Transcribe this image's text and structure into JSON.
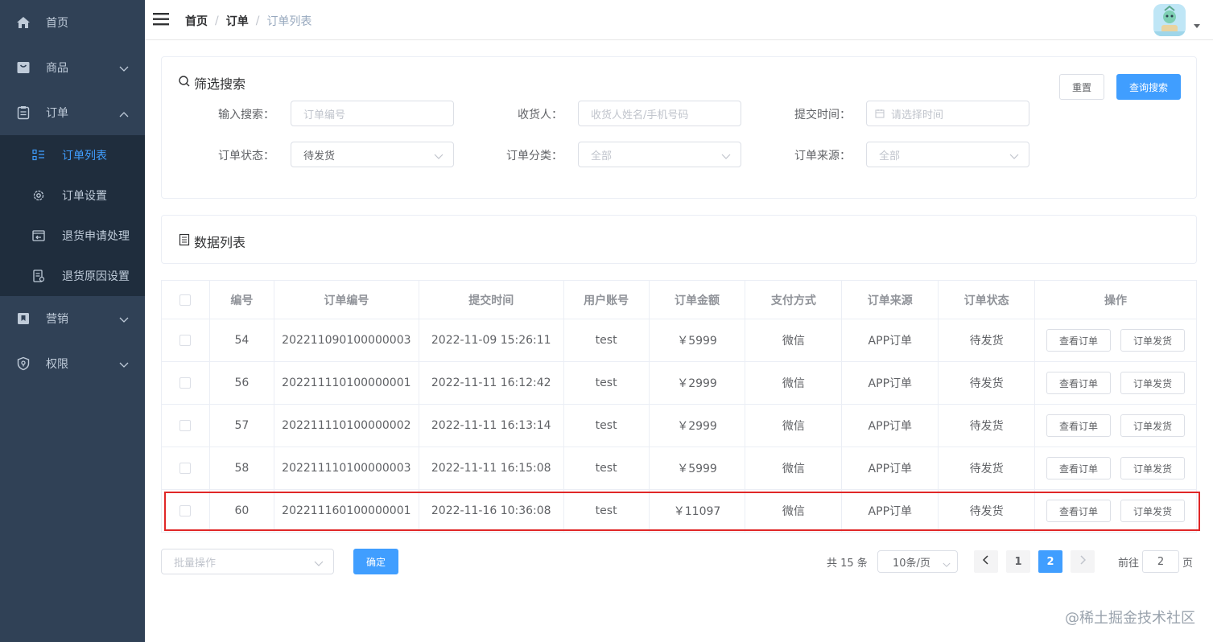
{
  "sidebar": {
    "items": [
      {
        "label": "首页",
        "icon": "home-icon"
      },
      {
        "label": "商品",
        "icon": "shopping-bag-icon"
      },
      {
        "label": "订单",
        "icon": "clipboard-icon"
      },
      {
        "label": "营销",
        "icon": "bookmark-icon"
      },
      {
        "label": "权限",
        "icon": "shield-icon"
      }
    ],
    "order_submenu": [
      {
        "label": "订单列表",
        "icon": "list-icon",
        "active": true
      },
      {
        "label": "订单设置",
        "icon": "gear-icon"
      },
      {
        "label": "退货申请处理",
        "icon": "return-icon"
      },
      {
        "label": "退货原因设置",
        "icon": "document-icon"
      }
    ]
  },
  "breadcrumb": [
    "首页",
    "订单",
    "订单列表"
  ],
  "breadcrumb_separator": "/",
  "filter": {
    "title": "筛选搜索",
    "reset_label": "重置",
    "search_label": "查询搜索",
    "fields": {
      "keyword": {
        "label": "输入搜索：",
        "placeholder": "订单编号"
      },
      "receiver": {
        "label": "收货人：",
        "placeholder": "收货人姓名/手机号码"
      },
      "submit_time": {
        "label": "提交时间：",
        "placeholder": "请选择时间"
      },
      "order_status": {
        "label": "订单状态：",
        "value": "待发货"
      },
      "order_category": {
        "label": "订单分类：",
        "placeholder": "全部"
      },
      "order_source": {
        "label": "订单来源：",
        "placeholder": "全部"
      }
    }
  },
  "data_list": {
    "title": "数据列表"
  },
  "table": {
    "columns": [
      "编号",
      "订单编号",
      "提交时间",
      "用户账号",
      "订单金额",
      "支付方式",
      "订单来源",
      "订单状态",
      "操作"
    ],
    "rows": [
      {
        "id": "54",
        "order_no": "202211090100000003",
        "time": "2022-11-09 15:26:11",
        "user": "test",
        "amount": "￥5999",
        "pay": "微信",
        "source": "APP订单",
        "status": "待发货"
      },
      {
        "id": "56",
        "order_no": "202211110100000001",
        "time": "2022-11-11 16:12:42",
        "user": "test",
        "amount": "￥2999",
        "pay": "微信",
        "source": "APP订单",
        "status": "待发货"
      },
      {
        "id": "57",
        "order_no": "202211110100000002",
        "time": "2022-11-11 16:13:14",
        "user": "test",
        "amount": "￥2999",
        "pay": "微信",
        "source": "APP订单",
        "status": "待发货"
      },
      {
        "id": "58",
        "order_no": "202211110100000003",
        "time": "2022-11-11 16:15:08",
        "user": "test",
        "amount": "￥5999",
        "pay": "微信",
        "source": "APP订单",
        "status": "待发货"
      },
      {
        "id": "60",
        "order_no": "202211160100000001",
        "time": "2022-11-16 10:36:08",
        "user": "test",
        "amount": "￥11097",
        "pay": "微信",
        "source": "APP订单",
        "status": "待发货"
      }
    ],
    "view_label": "查看订单",
    "ship_label": "订单发货"
  },
  "batch": {
    "placeholder": "批量操作",
    "confirm_label": "确定"
  },
  "pagination": {
    "total_text": "共 15 条",
    "page_size": "10条/页",
    "pages": [
      "1",
      "2"
    ],
    "current_page": "2",
    "goto_label": "前往",
    "goto_value": "2",
    "page_unit": "页"
  },
  "watermark": "@稀土掘金技术社区",
  "colors": {
    "sidebar_bg": "#304156",
    "submenu_bg": "#1f2d3d",
    "accent": "#409eff",
    "highlight": "#e02727"
  }
}
